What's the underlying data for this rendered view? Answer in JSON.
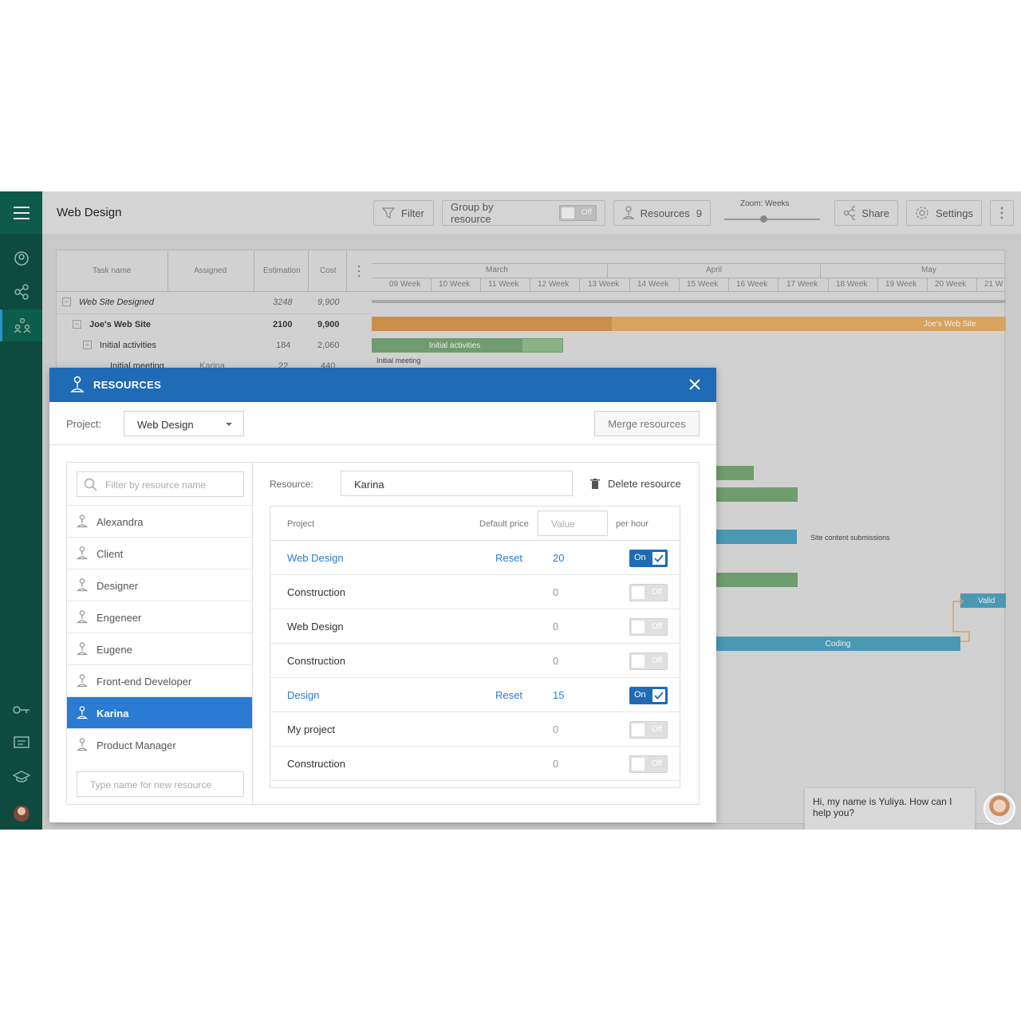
{
  "header": {
    "title": "Web Design",
    "filter_label": "Filter",
    "group_label": "Group by resource",
    "group_toggle": "Off",
    "resources_label": "Resources",
    "resources_count": "9",
    "zoom_label": "Zoom: Weeks",
    "share_label": "Share",
    "settings_label": "Settings"
  },
  "gantt": {
    "columns": [
      "Task name",
      "Assigned",
      "Estimation",
      "Cost"
    ],
    "rows": [
      {
        "name": "Web Site Designed",
        "assigned": "",
        "estimation": "3248",
        "cost": "9,900"
      },
      {
        "name": "Joe's Web Site",
        "assigned": "",
        "estimation": "2100",
        "cost": "9,900"
      },
      {
        "name": "Initial activities",
        "assigned": "",
        "estimation": "184",
        "cost": "2,060"
      },
      {
        "name": "Initial meeting",
        "assigned": "Karina",
        "estimation": "22",
        "cost": "440"
      }
    ],
    "months": [
      "March",
      "April",
      "May"
    ],
    "weeks": [
      "09 Week",
      "10 Week",
      "11 Week",
      "12 Week",
      "13 Week",
      "14 Week",
      "15 Week",
      "16 Week",
      "17 Week",
      "18 Week",
      "19 Week",
      "20 Week",
      "21 W"
    ],
    "bars": {
      "joes_site": "Joe's Web Site",
      "initial_activities": "Initial activities",
      "initial_meeting": "Initial meeting",
      "site_content": "Site content submissions",
      "coding": "Coding",
      "valid": "Valid"
    },
    "colors": {
      "orange": "#d7a35f",
      "green": "#6f9c6c",
      "blue": "#4a98b4"
    }
  },
  "modal": {
    "title": "RESOURCES",
    "project_label": "Project:",
    "project_value": "Web Design",
    "merge_label": "Merge resources",
    "filter_placeholder": "Filter by resource name",
    "new_placeholder": "Type name for new resource",
    "resources": [
      {
        "name": "Alexandra",
        "active": false
      },
      {
        "name": "Client",
        "active": false
      },
      {
        "name": "Designer",
        "active": false
      },
      {
        "name": "Engeneer",
        "active": false
      },
      {
        "name": "Eugene",
        "active": false
      },
      {
        "name": "Front-end Developer",
        "active": false
      },
      {
        "name": "Karina",
        "active": true
      },
      {
        "name": "Product Manager",
        "active": false
      }
    ],
    "resource_label": "Resource:",
    "resource_value": "Karina",
    "delete_label": "Delete resource",
    "table_headers": {
      "project": "Project",
      "default_price": "Default price",
      "value_placeholder": "Value",
      "per_hour": "per hour"
    },
    "table_rows": [
      {
        "project": "Web Design",
        "reset": "Reset",
        "price": "20",
        "state": "On"
      },
      {
        "project": "Construction",
        "reset": "",
        "price": "0",
        "state": "Off"
      },
      {
        "project": "Web Design",
        "reset": "",
        "price": "0",
        "state": "Off"
      },
      {
        "project": "Construction",
        "reset": "",
        "price": "0",
        "state": "Off"
      },
      {
        "project": "Design",
        "reset": "Reset",
        "price": "15",
        "state": "On"
      },
      {
        "project": "My project",
        "reset": "",
        "price": "0",
        "state": "Off"
      },
      {
        "project": "Construction",
        "reset": "",
        "price": "0",
        "state": "Off"
      }
    ]
  },
  "chat": {
    "message": "Hi, my name is Yuliya. How can I help you?"
  }
}
